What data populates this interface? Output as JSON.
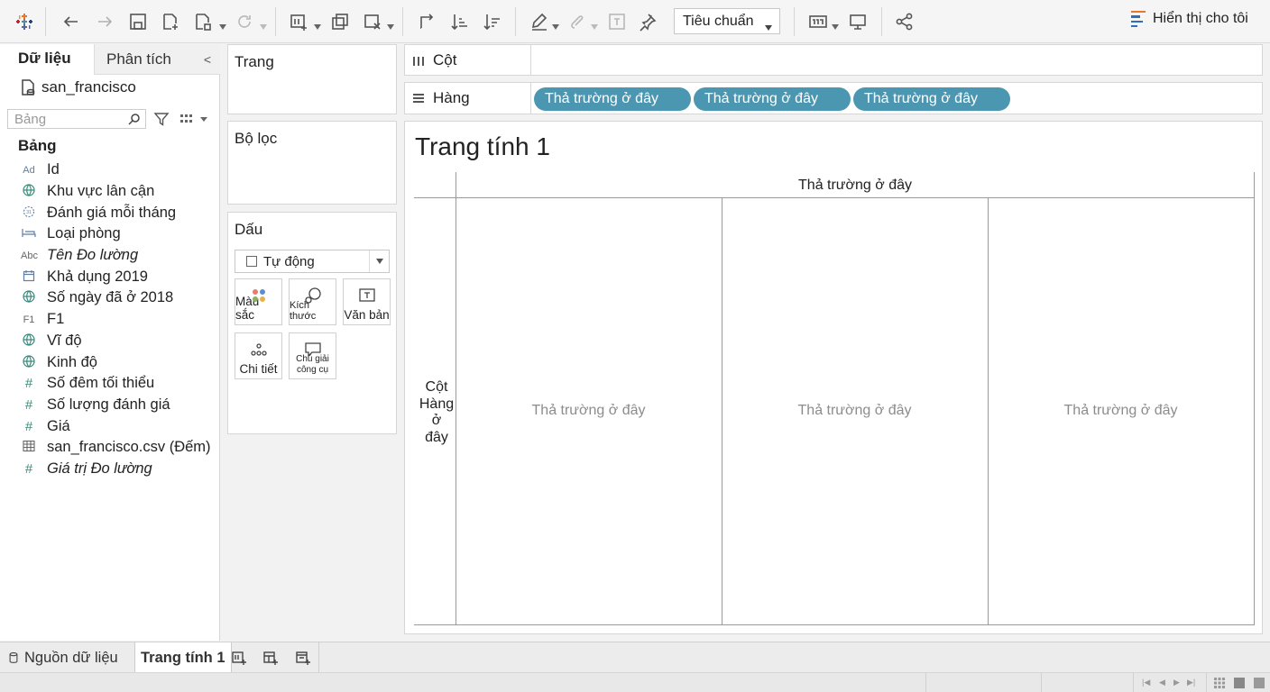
{
  "toolbar": {
    "icons": [
      "tableau-logo-icon",
      "undo-icon",
      "redo-icon",
      "save-icon",
      "new-datasource-icon",
      "pause-updates-icon",
      "refresh-icon",
      "new-worksheet-icon",
      "duplicate-icon",
      "clear-sheet-icon",
      "swap-icon",
      "sort-ascending-icon",
      "sort-descending-icon",
      "highlight-icon",
      "group-icon",
      "labels-icon",
      "pin-icon",
      "fit-icon",
      "presentation-icon",
      "share-icon"
    ],
    "fit_selector": "Tiêu chuẩn",
    "show_me": "Hiển thị cho tôi"
  },
  "data_pane": {
    "tab_data": "Dữ liệu",
    "tab_analysis": "Phân tích",
    "datasource": "san_francisco",
    "search_placeholder": "Bảng",
    "section": "Bảng",
    "fields": [
      {
        "icon": "Ad",
        "icon_name": "string-type-icon",
        "name": "Id"
      },
      {
        "icon": "globe",
        "icon_name": "geo-icon",
        "name": "Khu vực lân cận"
      },
      {
        "icon": "date",
        "icon_name": "date-type-icon",
        "name": "Đánh giá mỗi tháng"
      },
      {
        "icon": "bed",
        "icon_name": "room-type-icon",
        "name": "Loại phòng"
      },
      {
        "icon": "Abc",
        "icon_name": "measure-names-icon",
        "name": "Tên Đo lường"
      },
      {
        "icon": "cal",
        "icon_name": "calendar-icon",
        "name": "Khả dụng 2019"
      },
      {
        "icon": "globe",
        "icon_name": "geo-icon",
        "name": "Số ngày đã ở 2018"
      },
      {
        "icon": "F1",
        "icon_name": "string-type-icon",
        "name": "F1"
      },
      {
        "icon": "globe",
        "icon_name": "latitude-icon",
        "name": "Vĩ độ"
      },
      {
        "icon": "globe",
        "icon_name": "longitude-icon",
        "name": "Kinh độ"
      },
      {
        "icon": "#",
        "icon_name": "number-type-icon",
        "name": "Số đêm tối thiểu"
      },
      {
        "icon": "#",
        "icon_name": "number-type-icon",
        "name": "Số lượng đánh giá"
      },
      {
        "icon": "#",
        "icon_name": "number-type-icon",
        "name": "Giá"
      },
      {
        "icon": "tbl",
        "icon_name": "table-count-icon",
        "name": "san_francisco.csv (Đếm)"
      },
      {
        "icon": "#",
        "icon_name": "number-type-icon",
        "name": "Giá trị Đo lường"
      }
    ]
  },
  "shelves": {
    "pages": "Trang",
    "filters": "Bộ lọc",
    "marks": "Dấu",
    "mark_type": "Tự động",
    "mark_buttons": [
      "Màu sắc",
      "Kích thước",
      "Văn bản",
      "Chi tiết",
      "Chú giải công cụ"
    ],
    "columns": "Cột",
    "rows": "Hàng",
    "row_pills": [
      "Thả trường ở đây",
      "Thả trường ở đây",
      "Thả trường ở đây"
    ]
  },
  "view": {
    "title": "Trang tính 1",
    "column_header": "Thả trường ở đây",
    "row_header": [
      "Cột",
      "Hàng",
      "ở",
      "đây"
    ],
    "drop_zones": [
      "Thả trường ở đây",
      "Thả trường ở đây",
      "Thả trường ở đây"
    ]
  },
  "sheet_tabs": {
    "datasource": "Nguồn dữ liệu",
    "active": "Trang tính 1"
  }
}
